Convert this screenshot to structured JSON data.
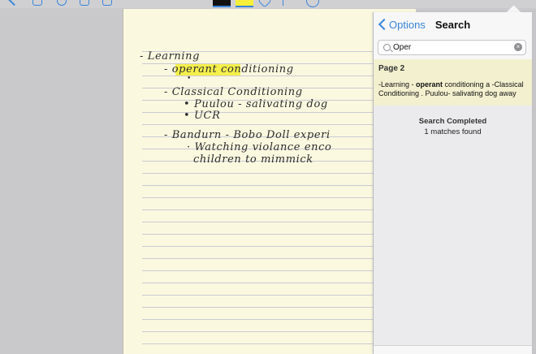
{
  "toolbar": {
    "icons": [
      "back-icon",
      "grid-icon",
      "info-icon",
      "sort-icon",
      "square-icon",
      "black-pen-icon",
      "yellow-highlighter-icon",
      "tag-icon",
      "share-icon",
      "user-icon"
    ]
  },
  "note": {
    "highlight_color": "#f4ee3c",
    "lines": [
      "- Learning",
      "- operant   conditioning",
      "•",
      "- Classical   Conditioning",
      "• Puulou - salivating  dog",
      "• UCR",
      "- Bandurn - Bobo   Doll  experi",
      "· Watching   violance  enco",
      "children  to   mimmick"
    ]
  },
  "panel": {
    "back_label": "Options",
    "title": "Search",
    "search": {
      "value": "Oper"
    },
    "result": {
      "page": "Page 2",
      "snippet_before": "-Learning - ",
      "snippet_match": "operant",
      "snippet_after": " conditioning a -Classical Conditioning . Puulou- salivating dog away"
    },
    "status_title": "Search Completed",
    "status_count": "1 matches found"
  }
}
